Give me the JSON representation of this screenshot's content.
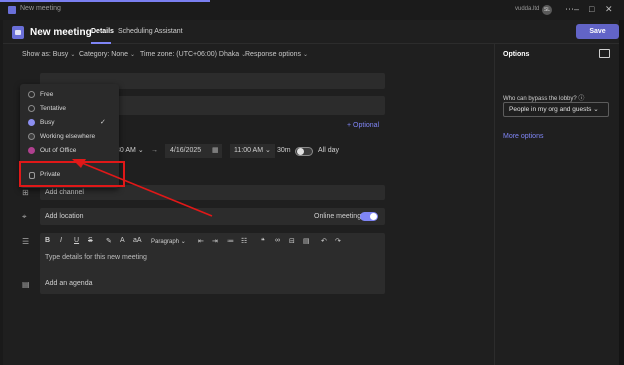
{
  "window": {
    "title": "New meeting",
    "user": "vudda.ltd",
    "avatar": "SL"
  },
  "header": {
    "title": "New meeting",
    "tabs": [
      {
        "label": "Details"
      },
      {
        "label": "Scheduling Assistant"
      }
    ],
    "save_label": "Save"
  },
  "toolbar": {
    "show_as": "Show as: Busy",
    "category": "Category: None",
    "timezone": "Time zone: (UTC+06:00) Dhaka",
    "response": "Response options"
  },
  "status_menu": {
    "items": [
      {
        "label": "Free",
        "color": "#2a2a2a",
        "checked": false
      },
      {
        "label": "Tentative",
        "color": "#2a2a2a",
        "checked": false
      },
      {
        "label": "Busy",
        "color": "#8c8ff0",
        "checked": true
      },
      {
        "label": "Working elsewhere",
        "color": "#3d3d3d",
        "checked": false
      },
      {
        "label": "Out of Office",
        "color": "#b0408f",
        "checked": false
      }
    ],
    "private_label": "Private"
  },
  "form": {
    "optional_label": "+ Optional",
    "start_time": "30 AM",
    "end_date": "4/16/2025",
    "end_time": "11:00 AM",
    "duration": "30m",
    "all_day_label": "All day",
    "channel_placeholder": "Add channel",
    "location_placeholder": "Add location",
    "online_meeting_label": "Online meeting",
    "details_placeholder": "Type details for this new meeting",
    "agenda_label": "Add an agenda"
  },
  "editor": {
    "paragraph_label": "Paragraph"
  },
  "options_panel": {
    "title": "Options",
    "lobby_label": "Who can bypass the lobby?",
    "lobby_value": "People in my org and guests",
    "more_options": "More options"
  },
  "colors": {
    "accent": "#6264c7",
    "link": "#7f85f5",
    "highlight": "#e01818"
  }
}
